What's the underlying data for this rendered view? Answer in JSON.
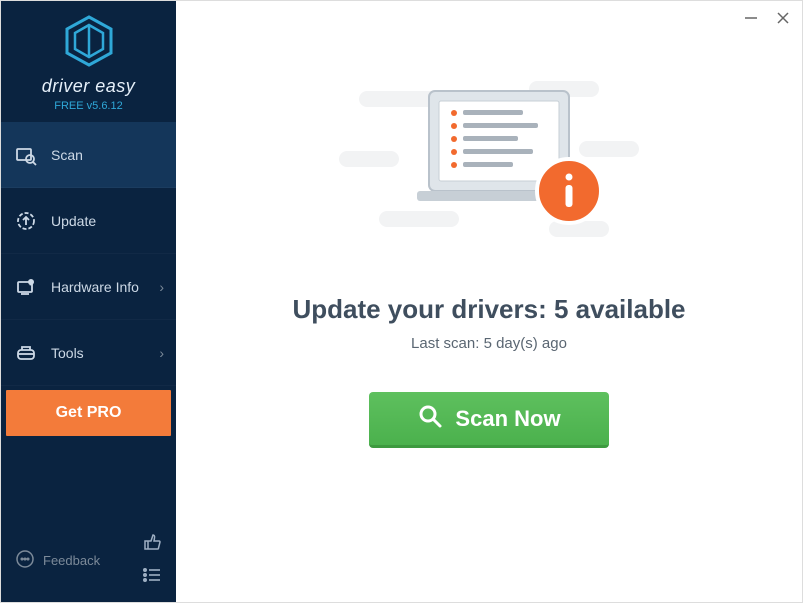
{
  "brand": {
    "name": "driver easy",
    "version": "FREE v5.6.12"
  },
  "sidebar": {
    "items": [
      {
        "label": "Scan",
        "icon": "scan-icon",
        "active": true,
        "chevron": false
      },
      {
        "label": "Update",
        "icon": "update-icon",
        "active": false,
        "chevron": false
      },
      {
        "label": "Hardware Info",
        "icon": "hardware-info-icon",
        "active": false,
        "chevron": true
      },
      {
        "label": "Tools",
        "icon": "tools-icon",
        "active": false,
        "chevron": true
      }
    ],
    "get_pro_label": "Get PRO",
    "feedback_label": "Feedback"
  },
  "main": {
    "headline": "Update your drivers: 5 available",
    "subline": "Last scan: 5 day(s) ago",
    "scan_button_label": "Scan Now"
  },
  "colors": {
    "accent_orange": "#f37b3a",
    "accent_green": "#4bb14d",
    "sidebar_bg": "#0a2340"
  }
}
